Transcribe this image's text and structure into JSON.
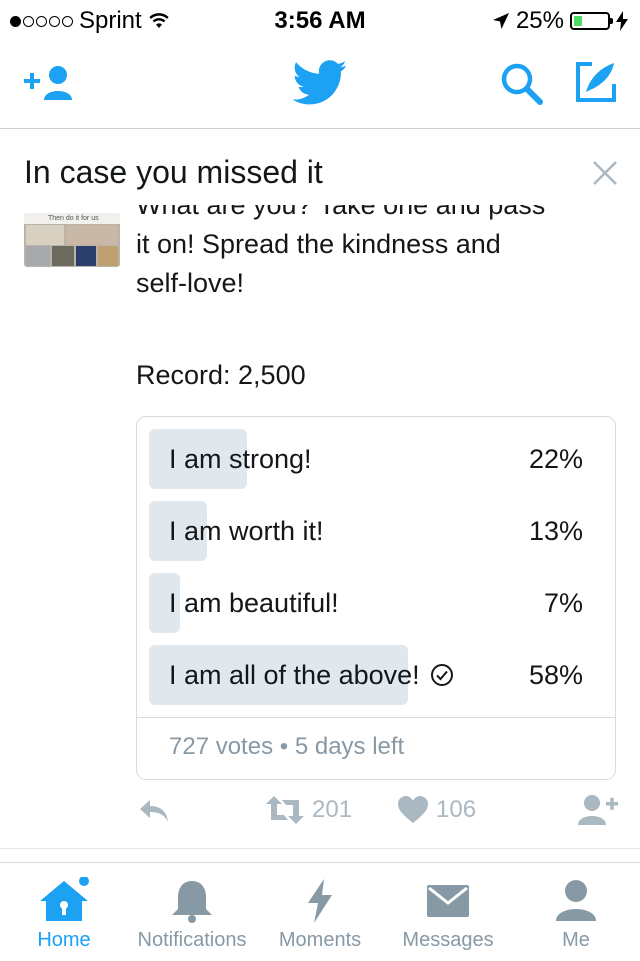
{
  "status_bar": {
    "carrier": "Sprint",
    "time": "3:56 AM",
    "battery": "25%",
    "battery_level": 0.25
  },
  "colors": {
    "accent": "#1da1f2",
    "muted": "#aab8c2",
    "poll_bar": "#e1e8ed"
  },
  "section": {
    "title": "In case you missed it"
  },
  "tweet": {
    "text_partial_line": "What are you?  Take one and pass",
    "text_line2": "it on!  Spread the kindness and",
    "text_line3": "self-love!",
    "record": "Record:  2,500",
    "thumbnail_caption": "Then do it for us"
  },
  "poll": {
    "options": [
      {
        "label": "I am strong!",
        "percent": "22%",
        "value": 22,
        "selected": false
      },
      {
        "label": "I am worth it!",
        "percent": "13%",
        "value": 13,
        "selected": false
      },
      {
        "label": "I am beautiful!",
        "percent": "7%",
        "value": 7,
        "selected": false
      },
      {
        "label": "I am all of the above!",
        "percent": "58%",
        "value": 58,
        "selected": true
      }
    ],
    "votes": "727 votes",
    "separator": "•",
    "time_left": "5 days left"
  },
  "actions": {
    "retweets": "201",
    "likes": "106"
  },
  "tabs": [
    {
      "label": "Home",
      "icon": "home-icon",
      "active": true
    },
    {
      "label": "Notifications",
      "icon": "bell-icon",
      "active": false
    },
    {
      "label": "Moments",
      "icon": "lightning-icon",
      "active": false
    },
    {
      "label": "Messages",
      "icon": "envelope-icon",
      "active": false
    },
    {
      "label": "Me",
      "icon": "person-icon",
      "active": false
    }
  ]
}
